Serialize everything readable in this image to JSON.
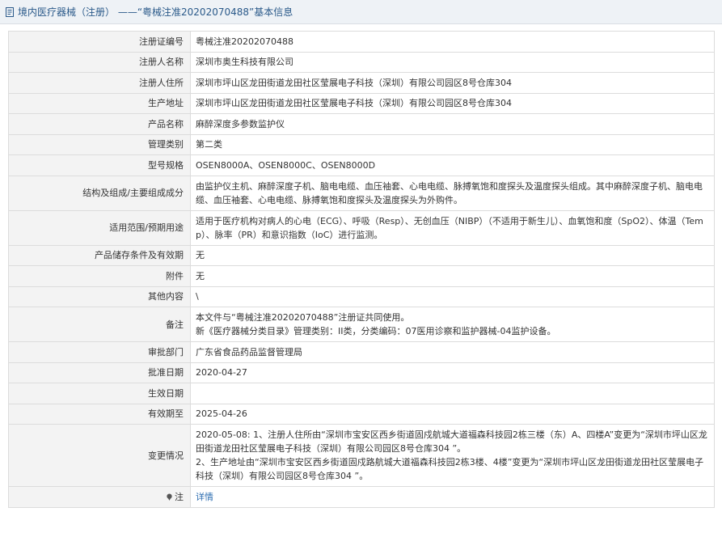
{
  "header": {
    "title": "境内医疗器械（注册） ——“粤械注准20202070488”基本信息"
  },
  "rows": [
    {
      "label": "注册证编号",
      "value": "粤械注准20202070488"
    },
    {
      "label": "注册人名称",
      "value": "深圳市奥生科技有限公司"
    },
    {
      "label": "注册人住所",
      "value": "深圳市坪山区龙田街道龙田社区莹展电子科技（深圳）有限公司园区8号仓库304"
    },
    {
      "label": "生产地址",
      "value": "深圳市坪山区龙田街道龙田社区莹展电子科技（深圳）有限公司园区8号仓库304"
    },
    {
      "label": "产品名称",
      "value": "麻醉深度多参数监护仪"
    },
    {
      "label": "管理类别",
      "value": "第二类"
    },
    {
      "label": "型号规格",
      "value": "OSEN8000A、OSEN8000C、OSEN8000D"
    },
    {
      "label": "结构及组成/主要组成成分",
      "value": "由监护仪主机、麻醉深度子机、脑电电缆、血压袖套、心电电缆、脉搏氧饱和度探头及温度探头组成。其中麻醉深度子机、脑电电缆、血压袖套、心电电缆、脉搏氧饱和度探头及温度探头为外购件。"
    },
    {
      "label": "适用范围/预期用途",
      "value": "适用于医疗机构对病人的心电（ECG）、呼吸（Resp）、无创血压（NIBP）（不适用于新生儿）、血氧饱和度（SpO2）、体温（Temp）、脉率（PR）和意识指数（IoC）进行监测。"
    },
    {
      "label": "产品储存条件及有效期",
      "value": "无"
    },
    {
      "label": "附件",
      "value": "无"
    },
    {
      "label": "其他内容",
      "value": "\\"
    },
    {
      "label": "备注",
      "lines": [
        "本文件与“粤械注准20202070488”注册证共同使用。",
        "新《医疗器械分类目录》管理类别：II类，分类编码：07医用诊察和监护器械-04监护设备。"
      ]
    },
    {
      "label": "审批部门",
      "value": "广东省食品药品监督管理局"
    },
    {
      "label": "批准日期",
      "value": "2020-04-27"
    },
    {
      "label": "生效日期",
      "value": ""
    },
    {
      "label": "有效期至",
      "value": "2025-04-26"
    },
    {
      "label": "变更情况",
      "lines": [
        "2020-05-08: 1、注册人住所由“深圳市宝安区西乡街道固戍航城大道福森科技园2栋三楼（东）A、四楼A”变更为“深圳市坪山区龙田街道龙田社区莹展电子科技（深圳）有限公司园区8号仓库304 ”。",
        "2、生产地址由“深圳市宝安区西乡街道固戍路航城大道福森科技园2栋3楼、4楼”变更为“深圳市坪山区龙田街道龙田社区莹展电子科技（深圳）有限公司园区8号仓库304 ”。"
      ]
    }
  ],
  "note": {
    "label": "注",
    "link_text": "详情"
  },
  "colors": {
    "label_bg": "#f3f3f3",
    "border": "#dcdcdc",
    "link": "#2b6cb0",
    "header_text": "#2b5a8a"
  }
}
